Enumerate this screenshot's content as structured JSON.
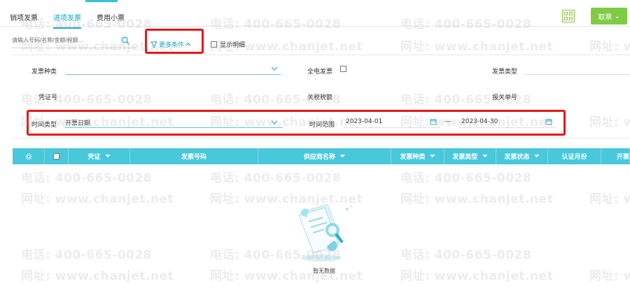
{
  "top": {
    "tabs": [
      {
        "label": "销项发票"
      },
      {
        "label": "进项发票",
        "active": true
      },
      {
        "label": "费用小票"
      }
    ],
    "action_button": "取票",
    "action_caret": "⌄"
  },
  "search": {
    "placeholder": "请输入号码/名称/金额/税额..."
  },
  "toolbar": {
    "more_conditions": "更多条件",
    "show_detail": "显示明细"
  },
  "filters": {
    "invoice_kind_label": "发票种类",
    "digital_invoice_label": "全电发票",
    "invoice_type_label": "发票类型",
    "voucher_no_label": "凭证号",
    "customs_tax_amount_label": "关税税额",
    "customs_no_label": "报关单号",
    "time_type_label": "时间类型",
    "time_type_value": "开票日期",
    "time_range_label": "时间范围",
    "start_date": "2023-04-01",
    "date_separator": "—",
    "end_date": "2023-04-30"
  },
  "table": {
    "columns": [
      "凭证",
      "发票号码",
      "供应商名称",
      "发票种类",
      "发票类型",
      "发票状态",
      "认证月份",
      "开票"
    ],
    "empty_text": "暂无数据"
  },
  "watermarks": {
    "phone": "电话: 400-665-0028",
    "site": "网址: www.chanjet.net"
  },
  "colors": {
    "accent": "#1aa7c2",
    "table_header": "#49c7db",
    "primary_button": "#7fcb44",
    "highlight": "#e51818"
  }
}
